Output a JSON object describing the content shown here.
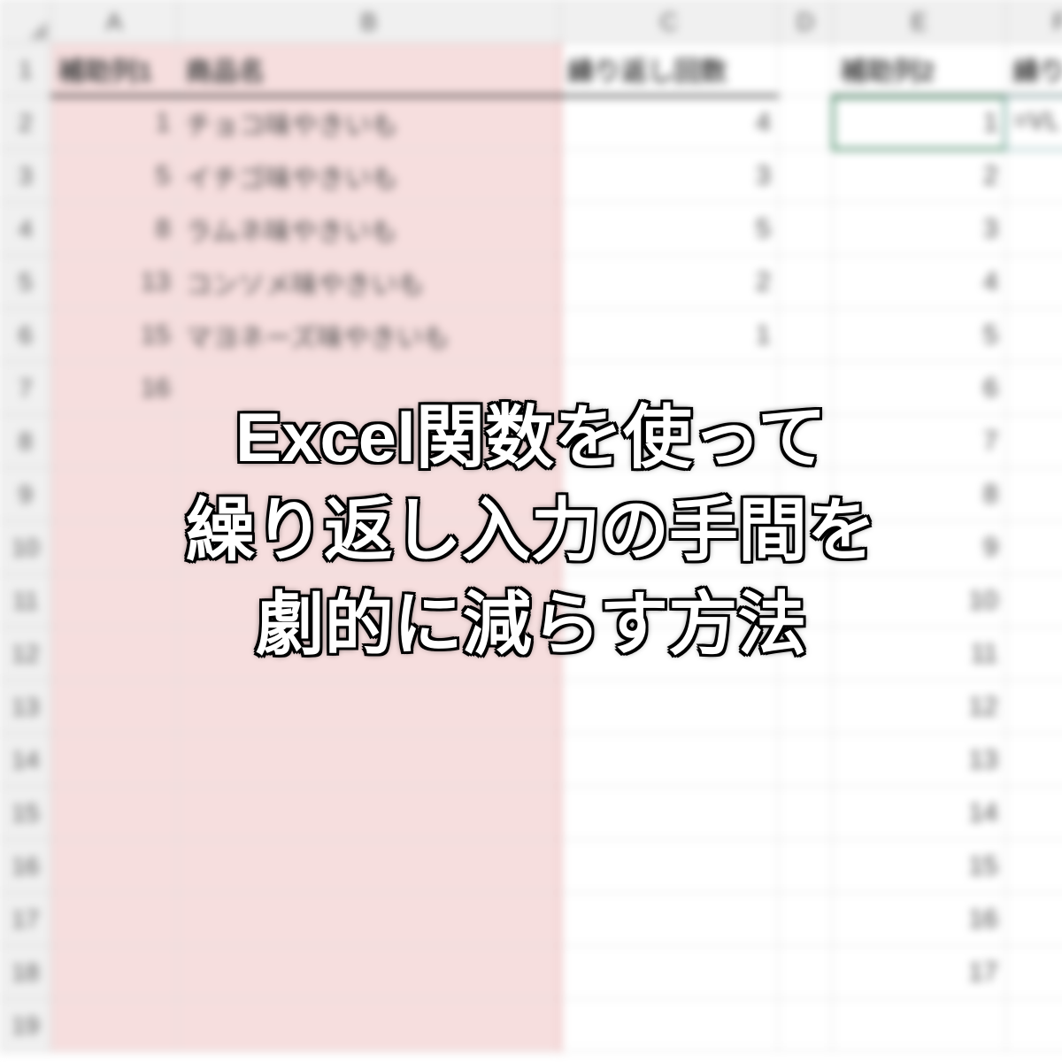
{
  "columns": [
    "A",
    "B",
    "C",
    "D",
    "E",
    "F"
  ],
  "row_count": 19,
  "headers": {
    "A": "補助列1",
    "B": "商品名",
    "C": "繰り返し回数",
    "D": "",
    "E": "補助列2",
    "F": "繰り"
  },
  "rows": [
    {
      "A": "1",
      "B": "チョコ味やきいも",
      "C": "4",
      "E": "1",
      "F": "=VL"
    },
    {
      "A": "5",
      "B": "イチゴ味やきいも",
      "C": "3",
      "E": "2"
    },
    {
      "A": "8",
      "B": "ラムネ味やきいも",
      "C": "5",
      "E": "3"
    },
    {
      "A": "13",
      "B": "コンソメ味やきいも",
      "C": "2",
      "E": "4"
    },
    {
      "A": "15",
      "B": "マヨネーズ味やきいも",
      "C": "1",
      "E": "5"
    },
    {
      "A": "16",
      "B": "",
      "C": "",
      "E": "6"
    },
    {
      "A": "",
      "B": "",
      "C": "",
      "E": "7"
    },
    {
      "A": "",
      "B": "",
      "C": "",
      "E": "8"
    },
    {
      "A": "",
      "B": "",
      "C": "",
      "E": "9"
    },
    {
      "A": "",
      "B": "",
      "C": "",
      "E": "10"
    },
    {
      "A": "",
      "B": "",
      "C": "",
      "E": "11"
    },
    {
      "A": "",
      "B": "",
      "C": "",
      "E": "12"
    },
    {
      "A": "",
      "B": "",
      "C": "",
      "E": "13"
    },
    {
      "A": "",
      "B": "",
      "C": "",
      "E": "14"
    },
    {
      "A": "",
      "B": "",
      "C": "",
      "E": "15"
    },
    {
      "A": "",
      "B": "",
      "C": "",
      "E": "16"
    },
    {
      "A": "",
      "B": "",
      "C": "",
      "E": "17"
    },
    {
      "A": "",
      "B": "",
      "C": "",
      "E": ""
    }
  ],
  "selected_cell": "E2",
  "overlay": {
    "line1": "Excel関数を使って",
    "line2": "繰り返し入力の手間を",
    "line3": "劇的に減らす方法"
  }
}
